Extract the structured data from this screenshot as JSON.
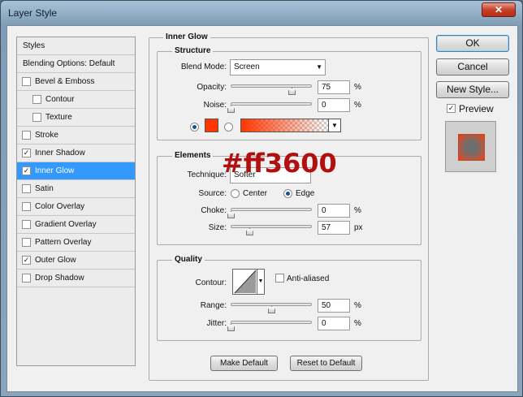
{
  "window": {
    "title": "Layer Style",
    "close_glyph": "✕"
  },
  "style_list": {
    "items": [
      {
        "label": "Styles",
        "type": "header",
        "checked": null,
        "selected": false
      },
      {
        "label": "Blending Options: Default",
        "type": "header",
        "checked": null,
        "selected": false
      },
      {
        "label": "Bevel & Emboss",
        "type": "check",
        "checked": false,
        "selected": false
      },
      {
        "label": "Contour",
        "type": "subcheck",
        "checked": false,
        "selected": false
      },
      {
        "label": "Texture",
        "type": "subcheck",
        "checked": false,
        "selected": false
      },
      {
        "label": "Stroke",
        "type": "check",
        "checked": false,
        "selected": false
      },
      {
        "label": "Inner Shadow",
        "type": "check",
        "checked": true,
        "selected": false
      },
      {
        "label": "Inner Glow",
        "type": "check",
        "checked": true,
        "selected": true
      },
      {
        "label": "Satin",
        "type": "check",
        "checked": false,
        "selected": false
      },
      {
        "label": "Color Overlay",
        "type": "check",
        "checked": false,
        "selected": false
      },
      {
        "label": "Gradient Overlay",
        "type": "check",
        "checked": false,
        "selected": false
      },
      {
        "label": "Pattern Overlay",
        "type": "check",
        "checked": false,
        "selected": false
      },
      {
        "label": "Outer Glow",
        "type": "check",
        "checked": true,
        "selected": false
      },
      {
        "label": "Drop Shadow",
        "type": "check",
        "checked": false,
        "selected": false
      }
    ]
  },
  "inner_glow": {
    "title": "Inner Glow",
    "structure": {
      "legend": "Structure",
      "blend_mode_label": "Blend Mode:",
      "blend_mode_value": "Screen",
      "opacity_label": "Opacity:",
      "opacity_value": "75",
      "opacity_fraction": 0.75,
      "noise_label": "Noise:",
      "noise_value": "0",
      "noise_fraction": 0,
      "percent": "%",
      "color_swatch": "#ff3600",
      "gradient_start": "#ff3600"
    },
    "elements": {
      "legend": "Elements",
      "technique_label": "Technique:",
      "technique_value": "Softer",
      "source_label": "Source:",
      "source_center": "Center",
      "source_edge": "Edge",
      "choke_label": "Choke:",
      "choke_value": "0",
      "choke_fraction": 0,
      "size_label": "Size:",
      "size_value": "57",
      "size_fraction": 0.228,
      "size_unit": "px",
      "percent": "%"
    },
    "quality": {
      "legend": "Quality",
      "contour_label": "Contour:",
      "antialiased_label": "Anti-aliased",
      "range_label": "Range:",
      "range_value": "50",
      "range_fraction": 0.5,
      "jitter_label": "Jitter:",
      "jitter_value": "0",
      "jitter_fraction": 0,
      "percent": "%"
    },
    "make_default_label": "Make Default",
    "reset_default_label": "Reset to Default"
  },
  "overlay_annotation": "#ff3600",
  "buttons": {
    "ok": "OK",
    "cancel": "Cancel",
    "new_style": "New Style...",
    "preview_label": "Preview",
    "preview_checked": true
  },
  "colors": {
    "accent_selected": "#3399ff",
    "glow_color": "#ff3600",
    "annotation_color": "#b21010"
  }
}
